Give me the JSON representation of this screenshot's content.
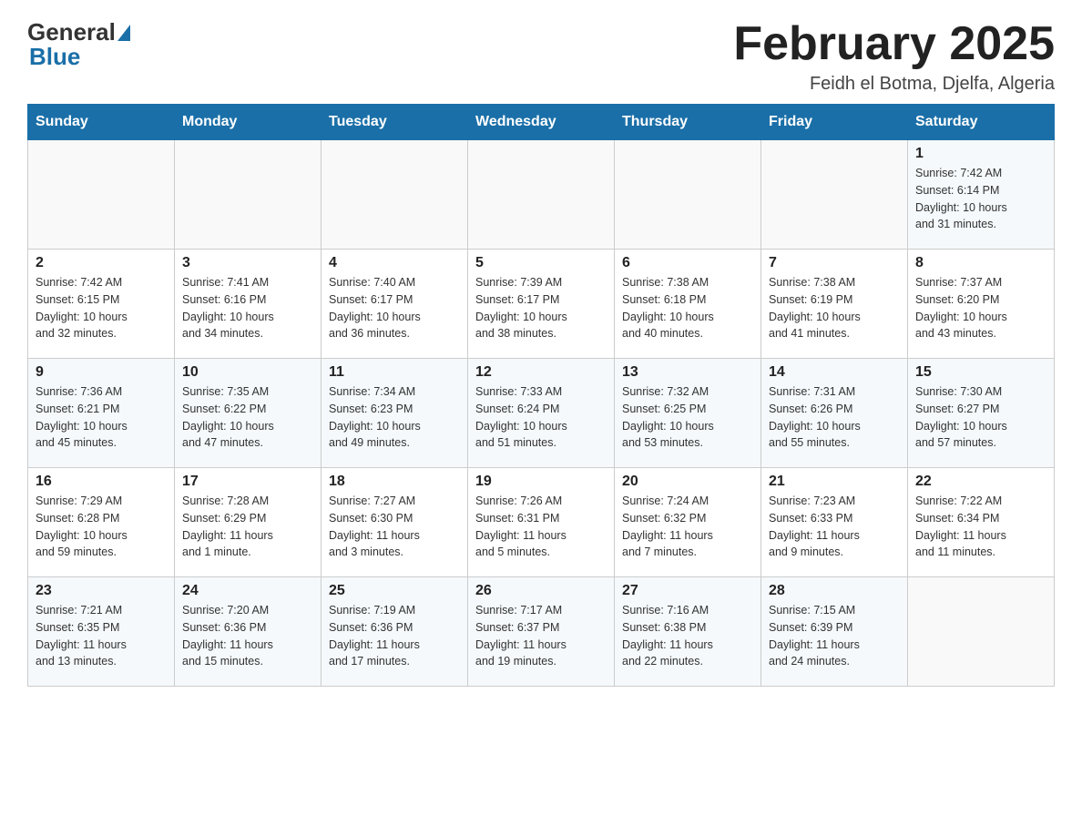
{
  "header": {
    "logo_general": "General",
    "logo_blue": "Blue",
    "title": "February 2025",
    "location": "Feidh el Botma, Djelfa, Algeria"
  },
  "weekdays": [
    "Sunday",
    "Monday",
    "Tuesday",
    "Wednesday",
    "Thursday",
    "Friday",
    "Saturday"
  ],
  "rows": [
    [
      {
        "day": "",
        "info": ""
      },
      {
        "day": "",
        "info": ""
      },
      {
        "day": "",
        "info": ""
      },
      {
        "day": "",
        "info": ""
      },
      {
        "day": "",
        "info": ""
      },
      {
        "day": "",
        "info": ""
      },
      {
        "day": "1",
        "info": "Sunrise: 7:42 AM\nSunset: 6:14 PM\nDaylight: 10 hours\nand 31 minutes."
      }
    ],
    [
      {
        "day": "2",
        "info": "Sunrise: 7:42 AM\nSunset: 6:15 PM\nDaylight: 10 hours\nand 32 minutes."
      },
      {
        "day": "3",
        "info": "Sunrise: 7:41 AM\nSunset: 6:16 PM\nDaylight: 10 hours\nand 34 minutes."
      },
      {
        "day": "4",
        "info": "Sunrise: 7:40 AM\nSunset: 6:17 PM\nDaylight: 10 hours\nand 36 minutes."
      },
      {
        "day": "5",
        "info": "Sunrise: 7:39 AM\nSunset: 6:17 PM\nDaylight: 10 hours\nand 38 minutes."
      },
      {
        "day": "6",
        "info": "Sunrise: 7:38 AM\nSunset: 6:18 PM\nDaylight: 10 hours\nand 40 minutes."
      },
      {
        "day": "7",
        "info": "Sunrise: 7:38 AM\nSunset: 6:19 PM\nDaylight: 10 hours\nand 41 minutes."
      },
      {
        "day": "8",
        "info": "Sunrise: 7:37 AM\nSunset: 6:20 PM\nDaylight: 10 hours\nand 43 minutes."
      }
    ],
    [
      {
        "day": "9",
        "info": "Sunrise: 7:36 AM\nSunset: 6:21 PM\nDaylight: 10 hours\nand 45 minutes."
      },
      {
        "day": "10",
        "info": "Sunrise: 7:35 AM\nSunset: 6:22 PM\nDaylight: 10 hours\nand 47 minutes."
      },
      {
        "day": "11",
        "info": "Sunrise: 7:34 AM\nSunset: 6:23 PM\nDaylight: 10 hours\nand 49 minutes."
      },
      {
        "day": "12",
        "info": "Sunrise: 7:33 AM\nSunset: 6:24 PM\nDaylight: 10 hours\nand 51 minutes."
      },
      {
        "day": "13",
        "info": "Sunrise: 7:32 AM\nSunset: 6:25 PM\nDaylight: 10 hours\nand 53 minutes."
      },
      {
        "day": "14",
        "info": "Sunrise: 7:31 AM\nSunset: 6:26 PM\nDaylight: 10 hours\nand 55 minutes."
      },
      {
        "day": "15",
        "info": "Sunrise: 7:30 AM\nSunset: 6:27 PM\nDaylight: 10 hours\nand 57 minutes."
      }
    ],
    [
      {
        "day": "16",
        "info": "Sunrise: 7:29 AM\nSunset: 6:28 PM\nDaylight: 10 hours\nand 59 minutes."
      },
      {
        "day": "17",
        "info": "Sunrise: 7:28 AM\nSunset: 6:29 PM\nDaylight: 11 hours\nand 1 minute."
      },
      {
        "day": "18",
        "info": "Sunrise: 7:27 AM\nSunset: 6:30 PM\nDaylight: 11 hours\nand 3 minutes."
      },
      {
        "day": "19",
        "info": "Sunrise: 7:26 AM\nSunset: 6:31 PM\nDaylight: 11 hours\nand 5 minutes."
      },
      {
        "day": "20",
        "info": "Sunrise: 7:24 AM\nSunset: 6:32 PM\nDaylight: 11 hours\nand 7 minutes."
      },
      {
        "day": "21",
        "info": "Sunrise: 7:23 AM\nSunset: 6:33 PM\nDaylight: 11 hours\nand 9 minutes."
      },
      {
        "day": "22",
        "info": "Sunrise: 7:22 AM\nSunset: 6:34 PM\nDaylight: 11 hours\nand 11 minutes."
      }
    ],
    [
      {
        "day": "23",
        "info": "Sunrise: 7:21 AM\nSunset: 6:35 PM\nDaylight: 11 hours\nand 13 minutes."
      },
      {
        "day": "24",
        "info": "Sunrise: 7:20 AM\nSunset: 6:36 PM\nDaylight: 11 hours\nand 15 minutes."
      },
      {
        "day": "25",
        "info": "Sunrise: 7:19 AM\nSunset: 6:36 PM\nDaylight: 11 hours\nand 17 minutes."
      },
      {
        "day": "26",
        "info": "Sunrise: 7:17 AM\nSunset: 6:37 PM\nDaylight: 11 hours\nand 19 minutes."
      },
      {
        "day": "27",
        "info": "Sunrise: 7:16 AM\nSunset: 6:38 PM\nDaylight: 11 hours\nand 22 minutes."
      },
      {
        "day": "28",
        "info": "Sunrise: 7:15 AM\nSunset: 6:39 PM\nDaylight: 11 hours\nand 24 minutes."
      },
      {
        "day": "",
        "info": ""
      }
    ]
  ]
}
